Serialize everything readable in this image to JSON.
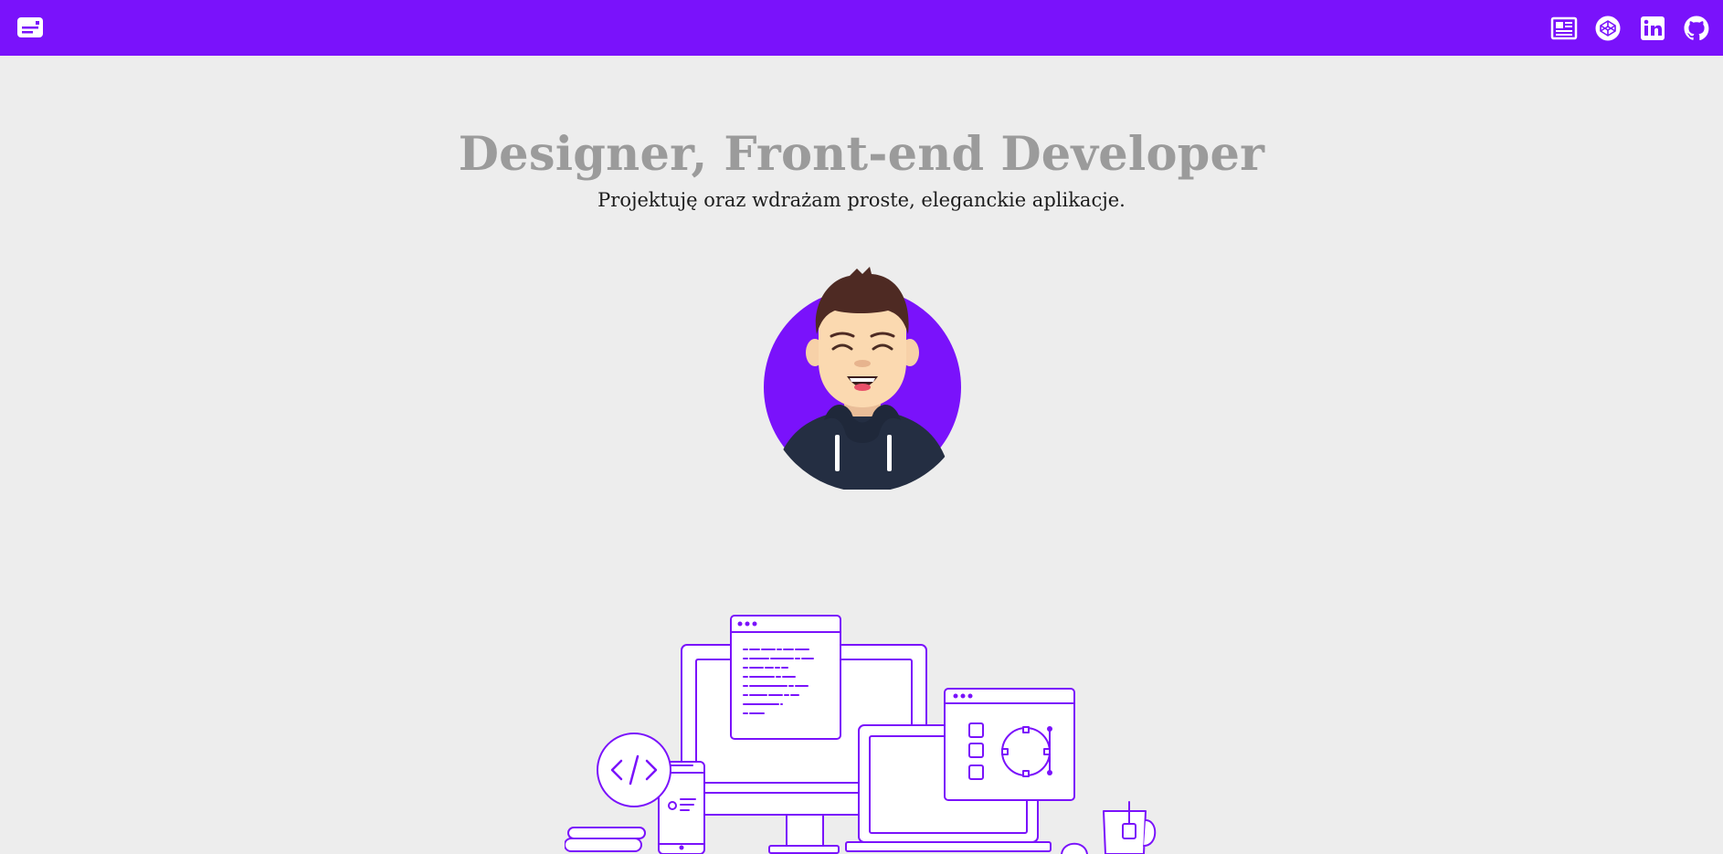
{
  "topbar": {
    "logo_icon": "id-card-icon",
    "social_icons": [
      "resume-icon",
      "codepen-icon",
      "linkedin-icon",
      "github-icon"
    ]
  },
  "hero": {
    "title": "Designer, Front-end Developer",
    "subtitle": "Projektuję oraz wdrażam proste, eleganckie aplikacje."
  },
  "colors": {
    "accent": "#7a12fb",
    "background": "#ededed",
    "title": "#9b9b9b",
    "subtitle": "#1d1d1d"
  }
}
